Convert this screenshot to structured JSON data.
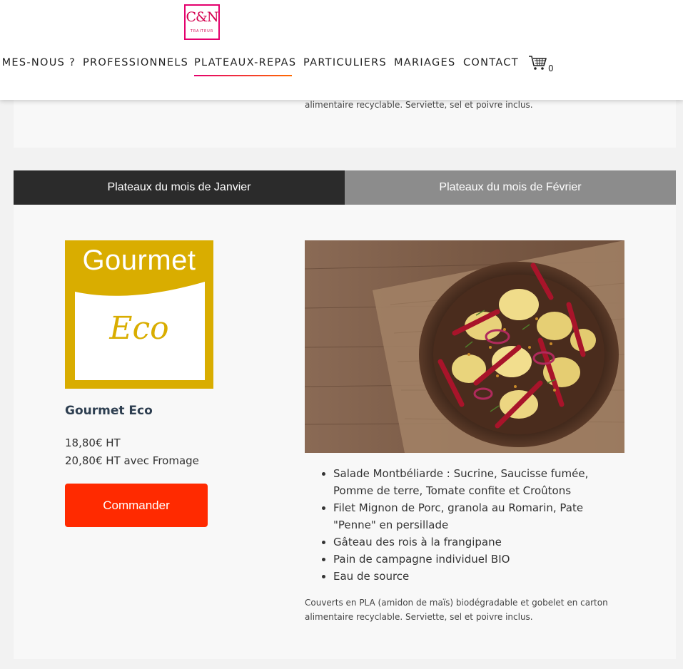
{
  "header": {
    "logo": {
      "text": "C&N",
      "subtitle": "TRAITEUR"
    },
    "nav": [
      {
        "label": "IMES-NOUS ?"
      },
      {
        "label": "PROFESSIONNELS"
      },
      {
        "label": "PLATEAUX-REPAS",
        "active": true
      },
      {
        "label": "PARTICULIERS"
      },
      {
        "label": "MARIAGES"
      },
      {
        "label": "CONTACT"
      }
    ],
    "cart": {
      "icon": "cart-icon",
      "count": "0"
    },
    "accent_gradient": [
      "#e4006d",
      "#ff6a00"
    ]
  },
  "previous_note": "alimentaire recyclable. Serviette, sel et poivre inclus.",
  "tabs": [
    {
      "label": "Plateaux du mois de Janvier",
      "active": true
    },
    {
      "label": "Plateaux du mois de Février",
      "active": false
    }
  ],
  "product": {
    "logo": {
      "word": "Gourmet",
      "script": "Eco",
      "color": "#d9ad00"
    },
    "name": "Gourmet Eco",
    "price": "18,80€ HT",
    "price_cheese": "20,80€ HT avec Fromage",
    "order_button": "Commander",
    "button_color": "#ff2a00",
    "menu": [
      "Salade Montbéliarde : Sucrine, Saucisse fumée, Pomme de terre, Tomate confite et Croûtons",
      "Filet Mignon de Porc, granola au Romarin, Pate \"Penne\" en persillade",
      "Gâteau des rois à la frangipane",
      "Pain de campagne individuel BIO",
      "Eau de source"
    ],
    "note": "Couverts en PLA (amidon de maïs) biodégradable et gobelet en carton alimentaire recyclable. Serviette, sel et poivre inclus."
  }
}
